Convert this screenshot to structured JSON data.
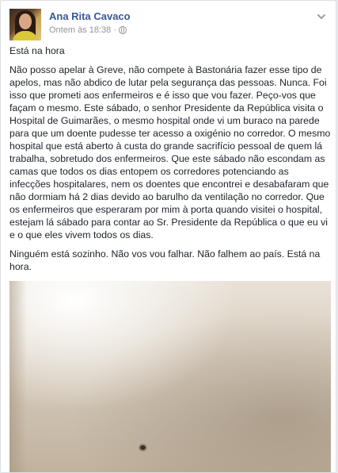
{
  "post": {
    "author": "Ana Rita Cavaco",
    "timestamp": "Ontem às 18:38",
    "privacy_icon": "globe-icon",
    "options_icon": "chevron-down-icon",
    "paragraphs": [
      "Está na hora",
      "Não posso apelar à Greve, não compete à Bastonária fazer esse tipo de apelos, mas não abdico de lutar pela segurança das pessoas. Nunca. Foi isso que prometi aos enfermeiros e é isso que vou fazer. Peço-vos que façam o mesmo. Este sábado, o senhor Presidente da República visita o Hospital de Guimarães, o mesmo hospital onde vi um buraco na parede para que um doente pudesse ter acesso a oxigénio no corredor. O mesmo hospital que está aberto à custa do grande sacrifício pessoal de quem lá trabalha, sobretudo dos enfermeiros. Que este sábado não escondam as camas que todos os dias entopem os corredores potenciando as infecções hospitalares, nem os doentes que encontrei e desabafaram que não dormiam há 2 dias devido ao barulho da ventilação no corredor. Que os enfermeiros que esperaram por mim à porta quando visitei o hospital, estejam lá sábado para contar ao Sr. Presidente da República o que eu vi e o que eles vivem todos os dias.",
      "Ninguém está sozinho. Não vos vou falhar. Não falhem ao país. Está na hora."
    ]
  },
  "colors": {
    "author_link": "#365899",
    "meta_text": "#90949c",
    "body_text": "#1d2129",
    "card_bg": "#ffffff",
    "page_bg": "#e9ebee"
  }
}
